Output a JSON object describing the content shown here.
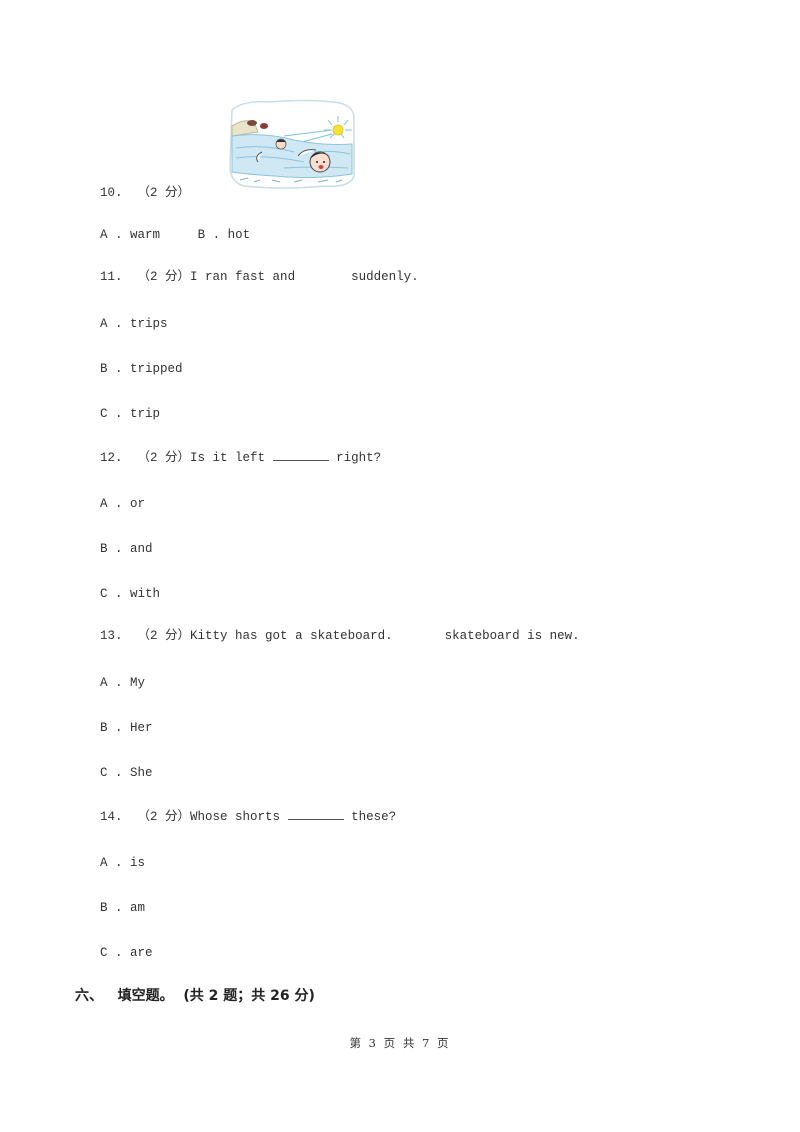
{
  "questions": [
    {
      "number": "10.",
      "points": "（2 分）",
      "stem_before": "",
      "stem_after": "",
      "image": "child-swimming-in-sea-under-sun-illustration",
      "options_inline": true,
      "options": [
        {
          "letter": "A .",
          "text": "warm"
        },
        {
          "letter": "B .",
          "text": "hot"
        }
      ]
    },
    {
      "number": "11.",
      "points": "（2 分）",
      "stem_before": "I ran fast and",
      "stem_after": "suddenly.",
      "options": [
        {
          "letter": "A .",
          "text": "trips"
        },
        {
          "letter": "B .",
          "text": "tripped"
        },
        {
          "letter": "C .",
          "text": "trip"
        }
      ]
    },
    {
      "number": "12.",
      "points": "（2 分）",
      "stem_before": "Is it left",
      "blank": "________",
      "stem_after": "right?",
      "options": [
        {
          "letter": "A .",
          "text": "or"
        },
        {
          "letter": "B .",
          "text": "and"
        },
        {
          "letter": "C .",
          "text": "with"
        }
      ]
    },
    {
      "number": "13.",
      "points": "（2 分）",
      "stem_before": "Kitty has got a skateboard.",
      "stem_after": "skateboard is new.",
      "options": [
        {
          "letter": "A .",
          "text": "My"
        },
        {
          "letter": "B .",
          "text": "Her"
        },
        {
          "letter": "C .",
          "text": "She"
        }
      ]
    },
    {
      "number": "14.",
      "points": "（2 分）",
      "stem_before": "Whose shorts",
      "blank": "________",
      "stem_after": "these?",
      "options": [
        {
          "letter": "A .",
          "text": "is"
        },
        {
          "letter": "B .",
          "text": "am"
        },
        {
          "letter": "C .",
          "text": "are"
        }
      ]
    }
  ],
  "section": {
    "number": "六、",
    "title": "填空题。",
    "summary": "(共 2 题；共 26 分)"
  },
  "footer": {
    "page_label": "第 3 页 共 7 页"
  }
}
